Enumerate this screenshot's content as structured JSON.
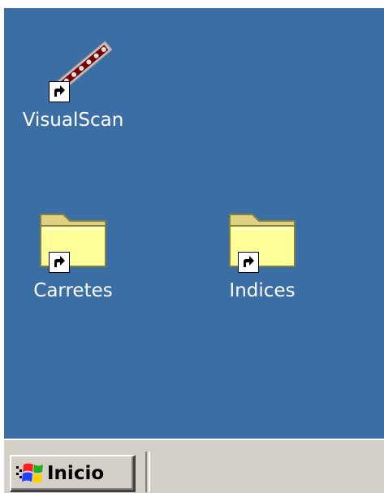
{
  "desktop": {
    "background_color": "#3a6ea5",
    "icons": [
      {
        "label": "VisualScan",
        "icon": "visualscan-shortcut-icon"
      },
      {
        "label": "Carretes",
        "icon": "folder-shortcut-icon"
      },
      {
        "label": "Indices",
        "icon": "folder-shortcut-icon"
      }
    ]
  },
  "taskbar": {
    "start_button": {
      "label": "Inicio",
      "icon": "windows-logo-icon"
    }
  }
}
